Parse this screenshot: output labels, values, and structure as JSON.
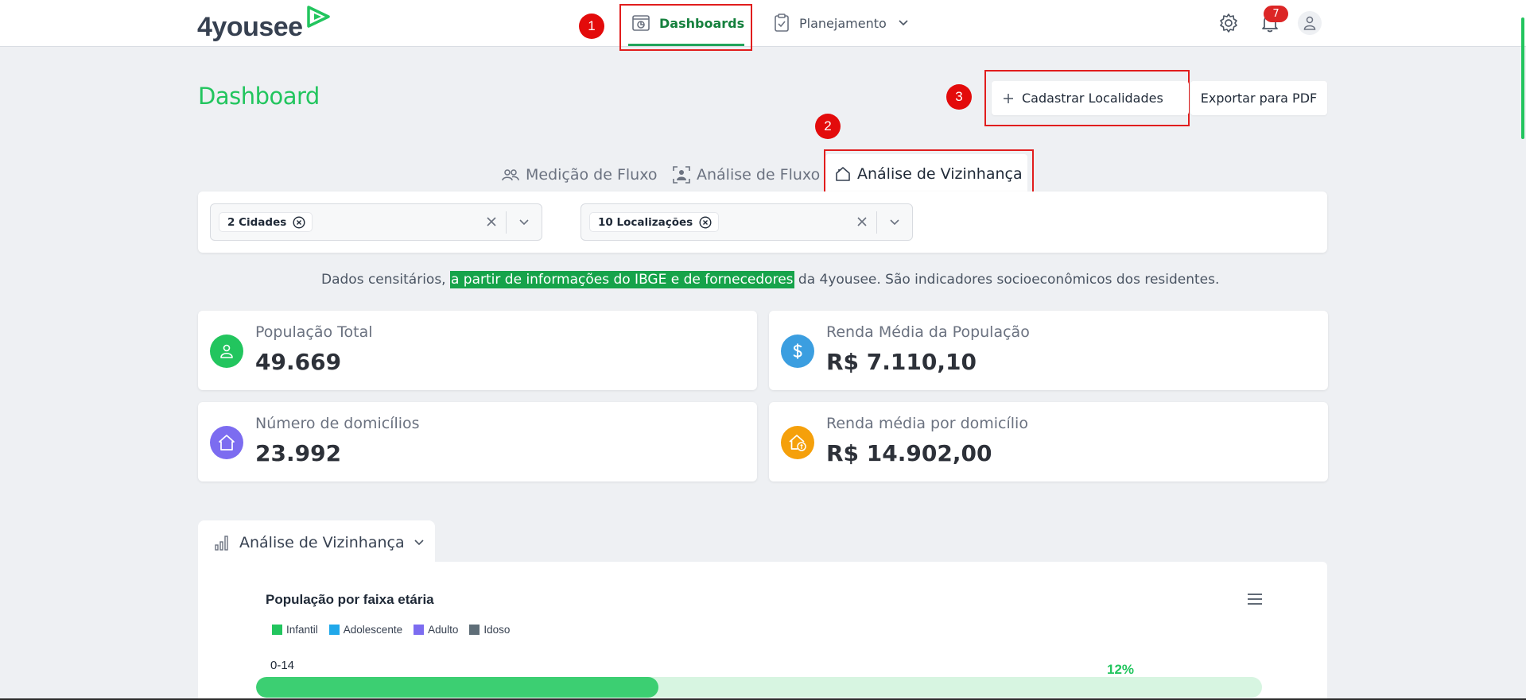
{
  "app": {
    "logo": "4yousee"
  },
  "nav": {
    "dashboards": "Dashboards",
    "planejamento": "Planejamento",
    "notifications": "7"
  },
  "annotations": [
    "1",
    "2",
    "3"
  ],
  "header": {
    "title": "Dashboard",
    "cadastrar": "Cadastrar Localidades",
    "exportar": "Exportar para PDF"
  },
  "tabs": {
    "medicao": "Medição de Fluxo",
    "analise_fluxo": "Análise de Fluxo",
    "vizinhanca": "Análise de Vizinhança"
  },
  "filters": {
    "cidades": "2 Cidades",
    "localizacoes": "10 Localizações"
  },
  "info": {
    "prefix": "Dados censitários, ",
    "highlight": "a partir de informações do IBGE e de fornecedores",
    "suffix": " da 4yousee. São indicadores socioeconômicos dos residentes."
  },
  "cards": [
    {
      "label": "População Total",
      "value": "49.669",
      "color": "#22c55e",
      "icon": "person-icon"
    },
    {
      "label": "Renda Média da População",
      "value": "R$ 7.110,10",
      "color": "#3b9ee0",
      "icon": "dollar-icon"
    },
    {
      "label": "Número de domicílios",
      "value": "23.992",
      "color": "#7c6cf0",
      "icon": "house-icon"
    },
    {
      "label": "Renda média por domicílio",
      "value": "R$ 14.902,00",
      "color": "#f5a00b",
      "icon": "house-dollar-icon"
    }
  ],
  "section": {
    "label": "Análise de Vizinhança"
  },
  "chart_data": {
    "type": "bar",
    "title": "População por faixa etária",
    "legend": [
      {
        "name": "Infantil",
        "color": "#22c55e"
      },
      {
        "name": "Adolescente",
        "color": "#20a8ea"
      },
      {
        "name": "Adulto",
        "color": "#7c6cf0"
      },
      {
        "name": "Idoso",
        "color": "#5f6e78"
      }
    ],
    "categories": [
      "0-14"
    ],
    "values": [
      12
    ],
    "value_labels": [
      "12%"
    ],
    "bar_fill_fraction": 0.4
  }
}
